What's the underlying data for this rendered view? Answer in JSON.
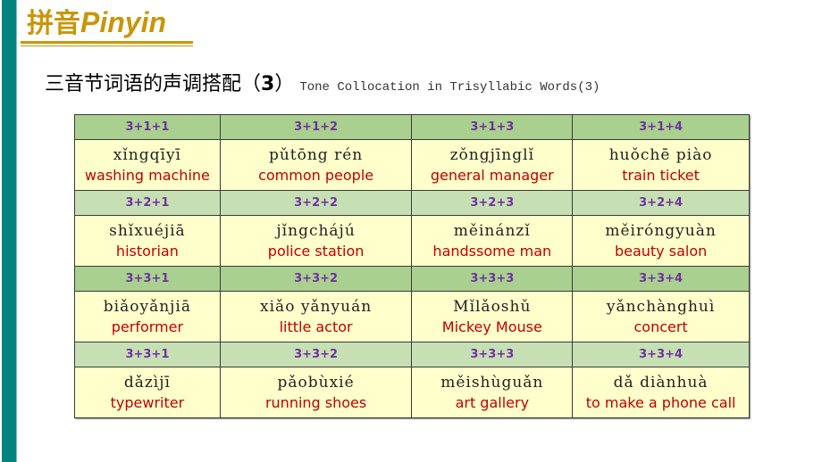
{
  "slide": {
    "brand_zh": "拼音",
    "brand_en": "Pinyin",
    "subtitle_zh": "三音节词语的声调搭配（",
    "subtitle_num": "3",
    "subtitle_close": "）",
    "subtitle_en": "Tone Collocation in Trisyllabic Words(3)",
    "colors": {
      "accent_gold": "#c8960a",
      "side_bar": "#00827f",
      "header_dark": "#a9d08e",
      "header_light": "#c6e0b4",
      "cell_bg": "#ffffcc",
      "tone_label": "#7030a0",
      "english": "#c00000"
    }
  },
  "table": {
    "groups": [
      {
        "headers": [
          "3+1+1",
          "3+1+2",
          "3+1+3",
          "3+1+4"
        ],
        "cells": [
          {
            "pinyin": "xǐngqīyī",
            "english": "washing machine"
          },
          {
            "pinyin": "pǔtōng rén",
            "english": "common people"
          },
          {
            "pinyin": "zǒngjīnglǐ",
            "english": "general manager"
          },
          {
            "pinyin": "huǒchē piào",
            "english": "train ticket"
          }
        ]
      },
      {
        "headers": [
          "3+2+1",
          "3+2+2",
          "3+2+3",
          "3+2+4"
        ],
        "cells": [
          {
            "pinyin": "shǐxuéjiā",
            "english": "historian"
          },
          {
            "pinyin": "jǐngchájú",
            "english": "police station"
          },
          {
            "pinyin": "měinánzǐ",
            "english": "handssome man"
          },
          {
            "pinyin": "měiróngyuàn",
            "english": "beauty salon"
          }
        ]
      },
      {
        "headers": [
          "3+3+1",
          "3+3+2",
          "3+3+3",
          "3+3+4"
        ],
        "cells": [
          {
            "pinyin": "biǎoyǎnjiā",
            "english": "performer"
          },
          {
            "pinyin": "xiǎo yǎnyuán",
            "english": "little actor"
          },
          {
            "pinyin": "Mǐlǎoshǔ",
            "english": "Mickey Mouse"
          },
          {
            "pinyin": "yǎnchànghuì",
            "english": "concert"
          }
        ]
      },
      {
        "headers": [
          "3+3+1",
          "3+3+2",
          "3+3+3",
          "3+3+4"
        ],
        "cells": [
          {
            "pinyin": "dǎzìjī",
            "english": "typewriter"
          },
          {
            "pinyin": "pǎobùxié",
            "english": "running shoes"
          },
          {
            "pinyin": "měishùguǎn",
            "english": "art gallery"
          },
          {
            "pinyin": "dǎ diànhuà",
            "english": "to make a phone call"
          }
        ]
      }
    ]
  }
}
